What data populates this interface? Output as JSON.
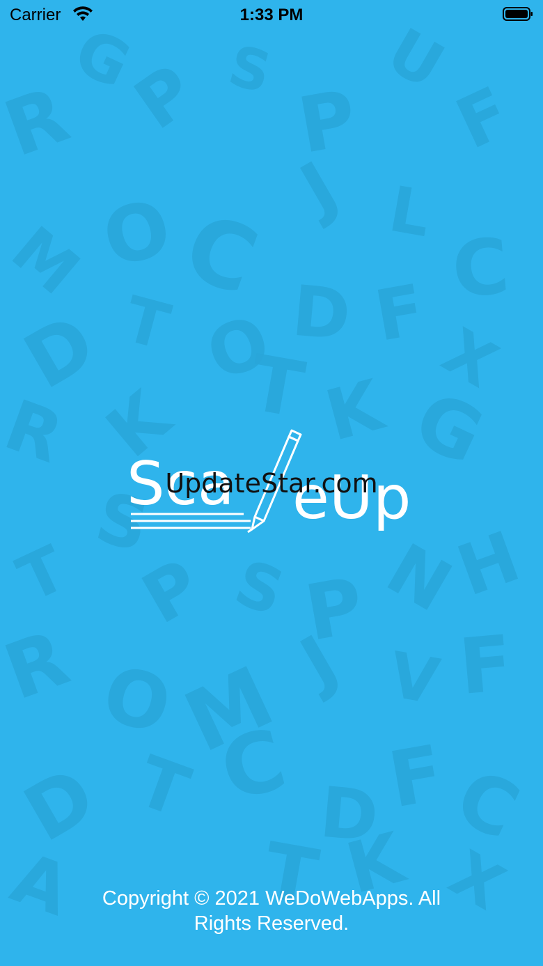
{
  "status_bar": {
    "carrier": "Carrier",
    "time": "1:33 PM"
  },
  "logo": {
    "text_part1": "Sca",
    "text_part2": "eUp",
    "icon": "pencil-icon"
  },
  "watermark": "UpdateStar.com",
  "footer": {
    "copyright": "Copyright © 2021 WeDoWebApps. All Rights Reserved."
  },
  "colors": {
    "background": "#2fb4ec",
    "pattern": "#29a6da",
    "logo": "#ffffff",
    "text": "#ffffff"
  }
}
